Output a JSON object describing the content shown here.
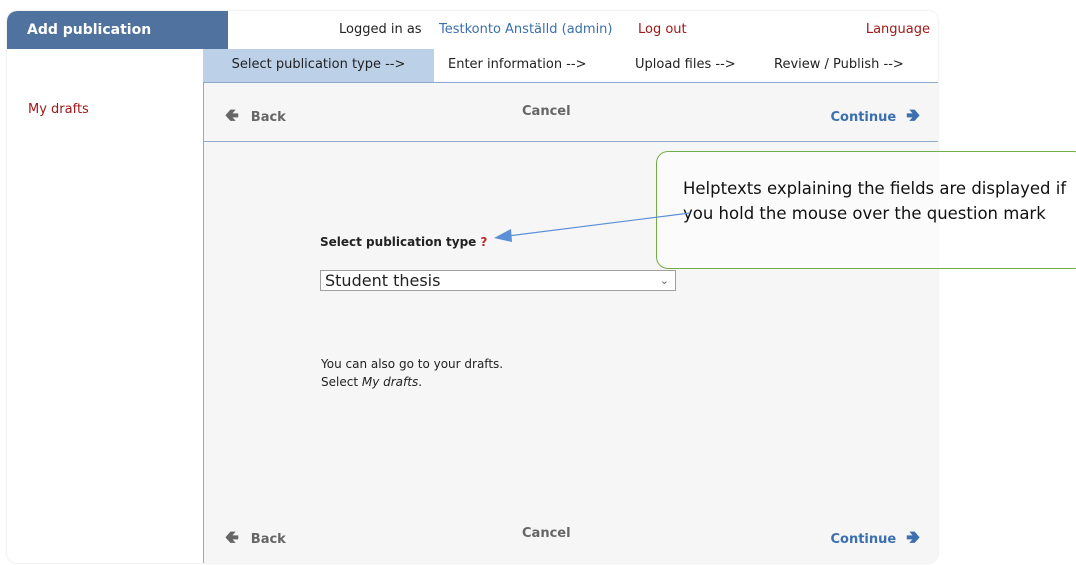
{
  "header": {
    "title": "Add publication",
    "logged_in_label": "Logged in as",
    "user_name": "Testkonto Anställd (admin)",
    "logout_label": "Log out",
    "language_label": "Language"
  },
  "sidebar": {
    "items": [
      {
        "label": "My drafts"
      }
    ]
  },
  "steps": [
    {
      "label": "Select publication type -->",
      "active": true
    },
    {
      "label": "Enter information -->",
      "active": false
    },
    {
      "label": "Upload files -->",
      "active": false
    },
    {
      "label": "Review / Publish -->",
      "active": false
    }
  ],
  "nav": {
    "back_label": "Back",
    "cancel_label": "Cancel",
    "continue_label": "Continue",
    "back_icon": "arrow-left-icon",
    "continue_icon": "arrow-right-icon"
  },
  "form": {
    "publication_type_label": "Select publication type",
    "help_mark": "?",
    "publication_type_value": "Student thesis",
    "drafts_note_line1": "You can also go to your drafts.",
    "drafts_note_line2_prefix": "Select ",
    "drafts_note_line2_link": "My drafts",
    "drafts_note_line2_suffix": "."
  },
  "callout": {
    "text": "Helptexts explaining the fields are displayed if you hold the mouse over the question mark"
  },
  "colors": {
    "header_bg": "#4f739e",
    "active_step_bg": "#bcd0e8",
    "link_red": "#a01818",
    "link_blue": "#3b6fb0",
    "callout_border": "#71ad47"
  }
}
